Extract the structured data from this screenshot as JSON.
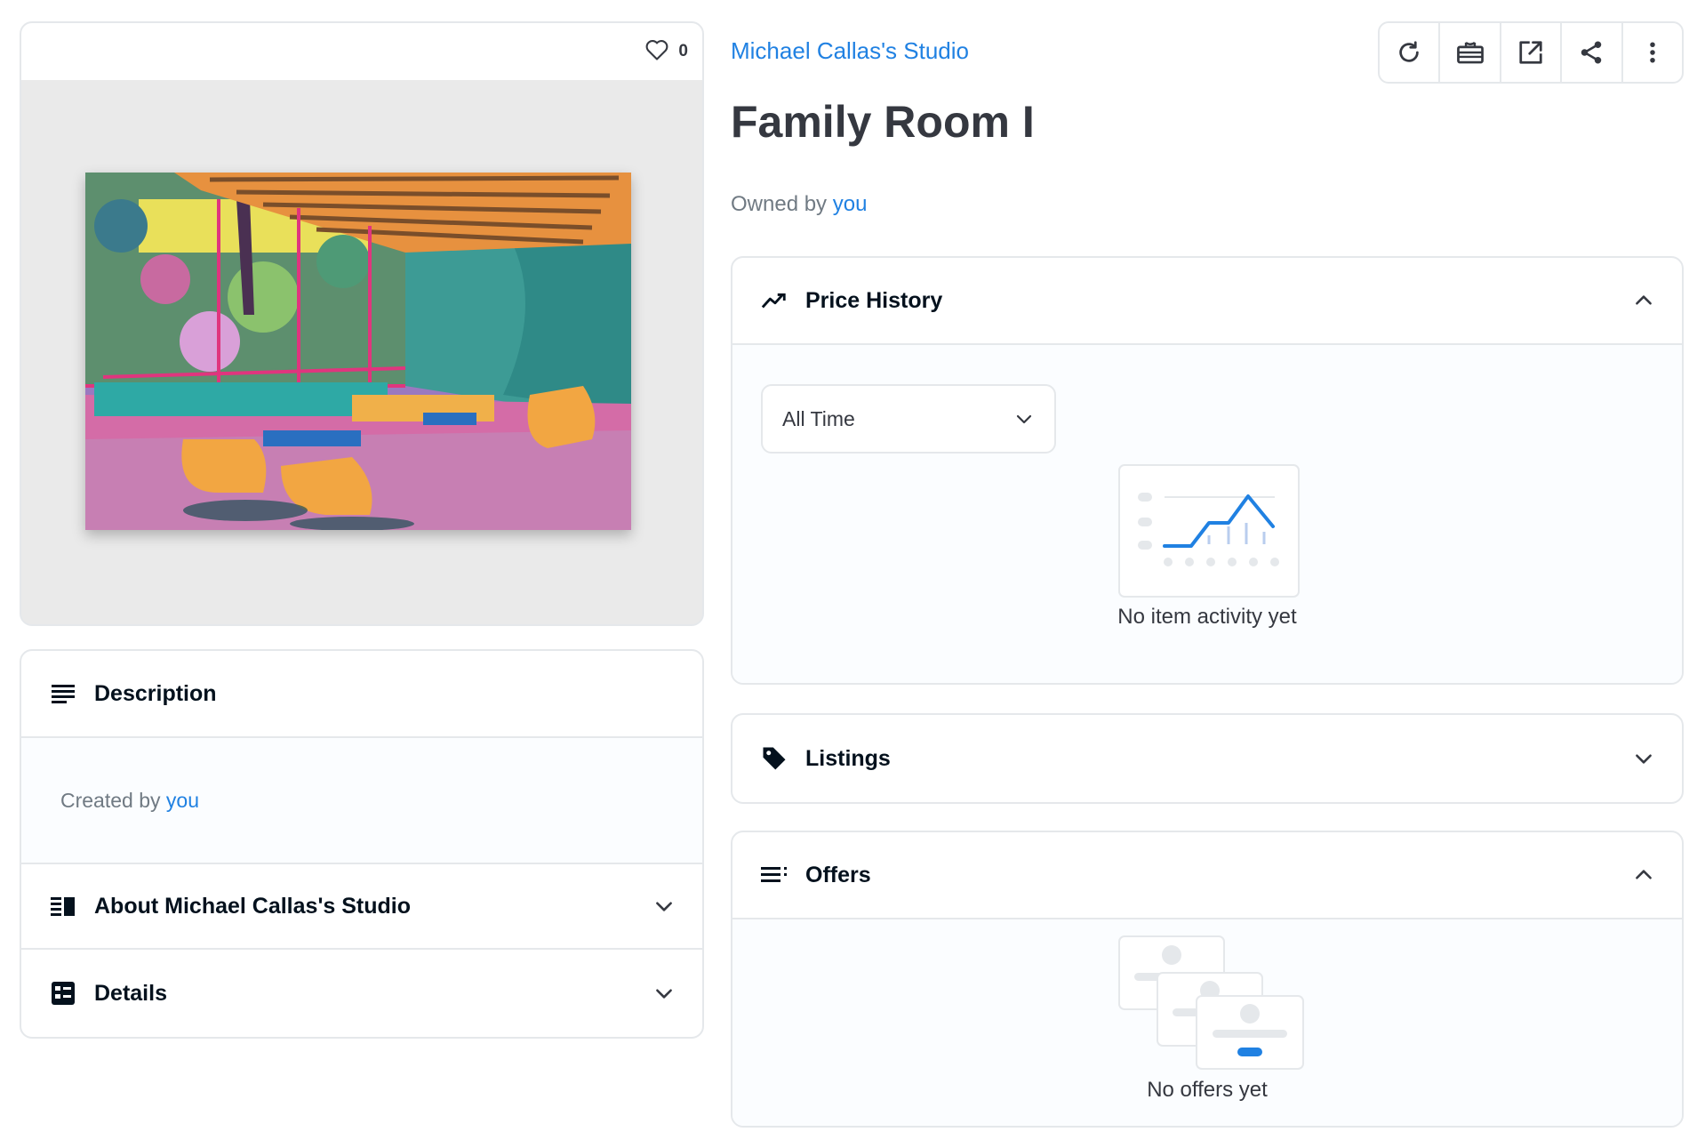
{
  "favorites": {
    "count": "0"
  },
  "artwork": {
    "alt": "Family Room I painting"
  },
  "description": {
    "title": "Description",
    "created_by_prefix": "Created by",
    "created_by_link": "you"
  },
  "about": {
    "title": "About Michael Callas's Studio"
  },
  "details": {
    "title": "Details"
  },
  "item": {
    "collection": "Michael Callas's Studio",
    "title": "Family Room I",
    "owned_by_prefix": "Owned by",
    "owned_by_link": "you"
  },
  "toolbar": {
    "icons": [
      "refresh-icon",
      "transfer-icon",
      "external-link-icon",
      "share-icon",
      "more-icon"
    ]
  },
  "price_history": {
    "title": "Price History",
    "range_value": "All Time",
    "empty_text": "No item activity yet"
  },
  "listings": {
    "title": "Listings"
  },
  "offers": {
    "title": "Offers",
    "empty_text": "No offers yet"
  },
  "colors": {
    "accent": "#2081e2",
    "border": "#e5e8eb",
    "muted": "#707a83"
  }
}
